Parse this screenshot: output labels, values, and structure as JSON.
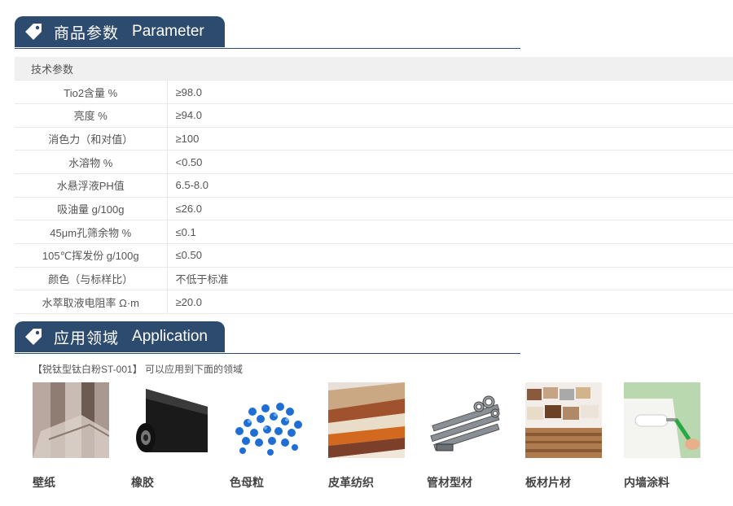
{
  "sections": {
    "parameter": {
      "title_zh": "商品参数",
      "title_en": "Parameter"
    },
    "application": {
      "title_zh": "应用领域",
      "title_en": "Application"
    }
  },
  "table": {
    "header": "技术参数",
    "rows": [
      {
        "name": "Tio2含量 %",
        "value": "≥98.0"
      },
      {
        "name": "亮度 %",
        "value": "≥94.0"
      },
      {
        "name": "消色力（和对值）",
        "value": "≥100"
      },
      {
        "name": "水溶物 %",
        "value": "<0.50"
      },
      {
        "name": "水悬浮液PH值",
        "value": "6.5-8.0"
      },
      {
        "name": "吸油量 g/100g",
        "value": "≤26.0"
      },
      {
        "name": "45μm孔筛余物 %",
        "value": "≤0.1"
      },
      {
        "name": "105℃挥发份 g/100g",
        "value": "≤0.50"
      },
      {
        "name": "颜色（与标样比）",
        "value": "不低于标准"
      },
      {
        "name": "水萃取液电阻率 Ω·m",
        "value": "≥20.0"
      }
    ]
  },
  "application_intro": "【锐钛型钛白粉ST-001】 可以应用到下面的领域",
  "applications": [
    {
      "label": "壁纸",
      "icon": "wallpaper-rolls-image"
    },
    {
      "label": "橡胶",
      "icon": "rubber-sheet-image"
    },
    {
      "label": "色母粒",
      "icon": "masterbatch-pellets-image"
    },
    {
      "label": "皮革纺织",
      "icon": "leather-textile-image"
    },
    {
      "label": "管材型材",
      "icon": "pipes-profiles-image"
    },
    {
      "label": "板材片材",
      "icon": "board-sheets-image"
    },
    {
      "label": "内墙涂料",
      "icon": "interior-paint-image"
    }
  ]
}
